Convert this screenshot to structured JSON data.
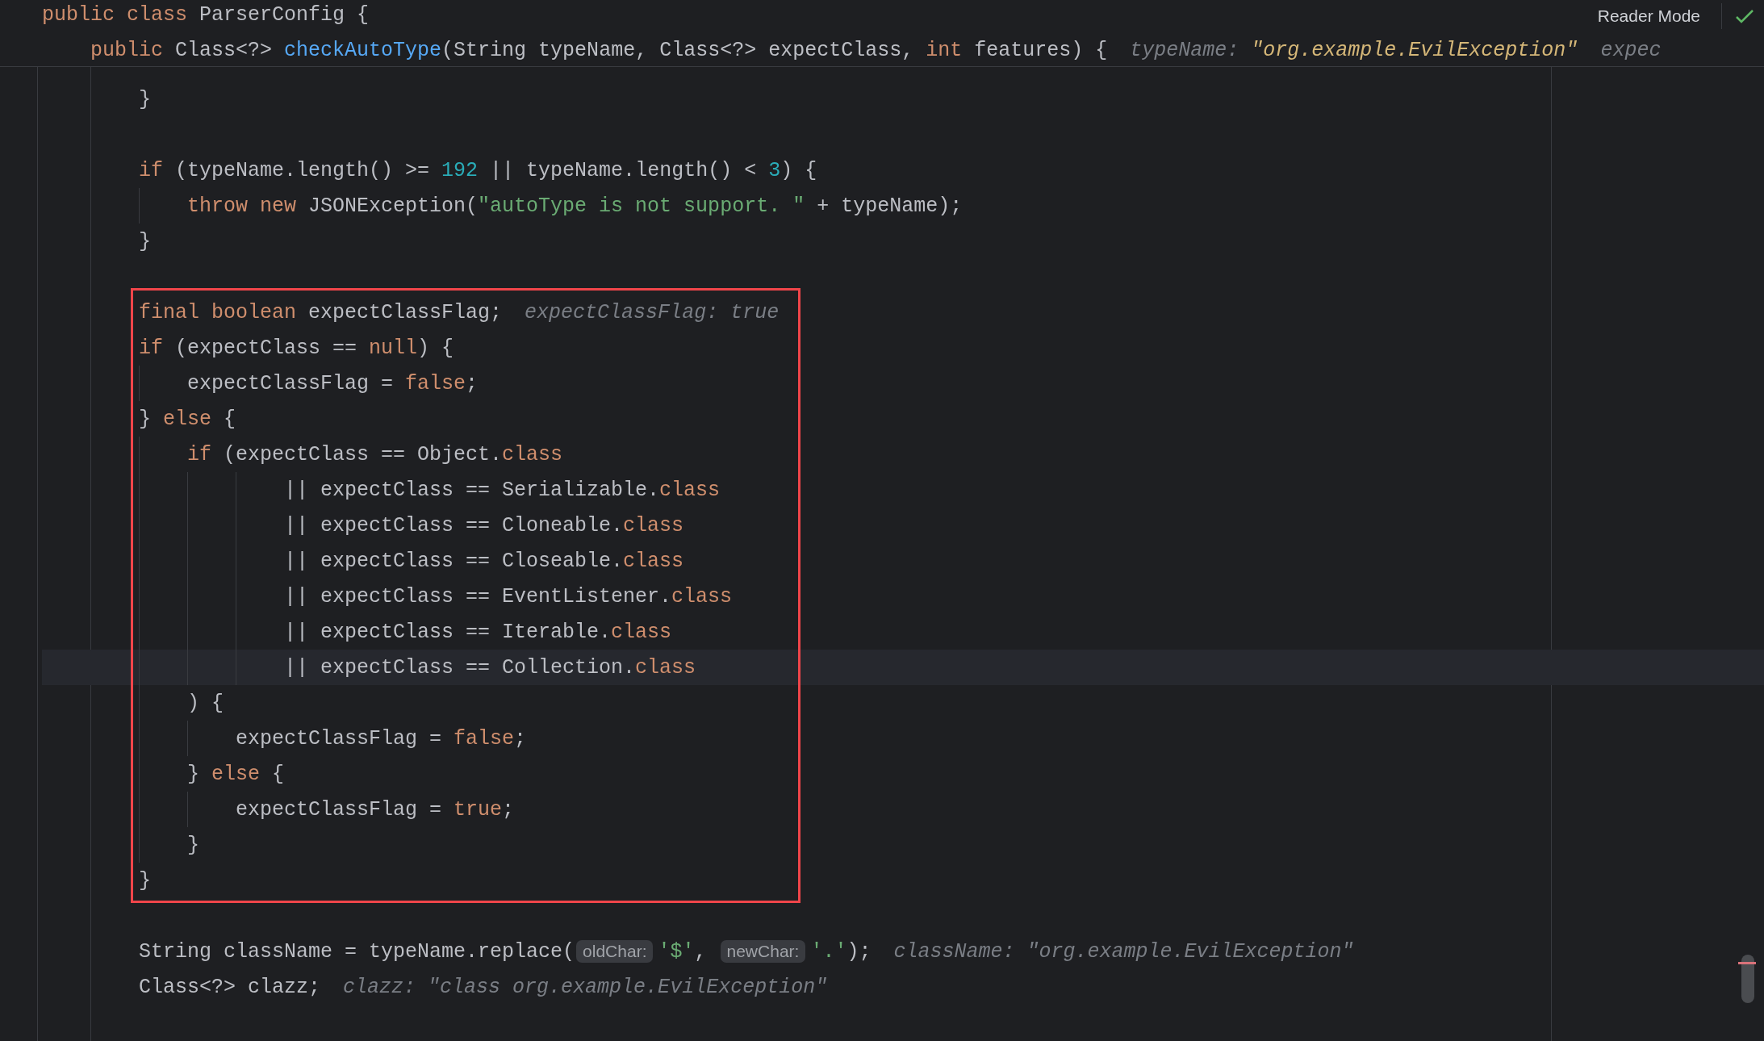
{
  "sticky_header": {
    "lines": [
      {
        "kind": "code",
        "code": [
          {
            "kind": "keyword",
            "text": "public class"
          },
          {
            "kind": "plain",
            "text": " ParserConfig {"
          }
        ],
        "children": [
          {
            "kind": "code",
            "code": [
              {
                "kind": "keyword",
                "text": "public"
              },
              {
                "kind": "plain",
                "text": " Class<?> "
              },
              {
                "kind": "function",
                "text": "checkAutoType"
              },
              {
                "kind": "plain",
                "text": "(String typeName, Class<?> expectClass, "
              },
              {
                "kind": "keyword",
                "text": "int"
              },
              {
                "kind": "plain",
                "text": " features) {"
              },
              {
                "kind": "debug",
                "name": "typeName:",
                "value": "\"org.example.EvilException\"",
                "changed": true
              },
              {
                "kind": "debug",
                "name": "expec"
              }
            ]
          }
        ]
      }
    ]
  },
  "reader_mode": {
    "label": "Reader Mode",
    "checked": true
  },
  "editor": {
    "sections": [
      {
        "kind": "plain",
        "lines": [
          {
            "kind": "code",
            "current": false,
            "code": [
              {
                "kind": "plain",
                "text": "}"
              }
            ]
          },
          {
            "kind": "blank"
          },
          {
            "kind": "code",
            "current": false,
            "code": [
              {
                "kind": "keyword",
                "text": "if"
              },
              {
                "kind": "plain",
                "text": " (typeName.length() >= "
              },
              {
                "kind": "number",
                "text": "192"
              },
              {
                "kind": "plain",
                "text": " || typeName.length() < "
              },
              {
                "kind": "number",
                "text": "3"
              },
              {
                "kind": "plain",
                "text": ") {"
              }
            ],
            "children": [
              {
                "kind": "code",
                "current": false,
                "code": [
                  {
                    "kind": "keyword",
                    "text": "throw new"
                  },
                  {
                    "kind": "plain",
                    "text": " JSONException("
                  },
                  {
                    "kind": "string",
                    "text": "\"autoType is not support. \""
                  },
                  {
                    "kind": "plain",
                    "text": " + typeName);"
                  }
                ]
              }
            ]
          },
          {
            "kind": "code",
            "current": false,
            "code": [
              {
                "kind": "plain",
                "text": "}"
              }
            ]
          },
          {
            "kind": "blank"
          }
        ]
      },
      {
        "kind": "boxed",
        "lines": [
          {
            "kind": "code",
            "current": false,
            "code": [
              {
                "kind": "keyword",
                "text": "final boolean"
              },
              {
                "kind": "plain",
                "text": " expectClassFlag;"
              },
              {
                "kind": "debug",
                "name": "expectClassFlag:",
                "value": "true",
                "changed": false
              }
            ]
          },
          {
            "kind": "code",
            "current": false,
            "code": [
              {
                "kind": "keyword",
                "text": "if"
              },
              {
                "kind": "plain",
                "text": " (expectClass == "
              },
              {
                "kind": "keyword",
                "text": "null"
              },
              {
                "kind": "plain",
                "text": ") {"
              }
            ],
            "children": [
              {
                "kind": "code",
                "current": false,
                "code": [
                  {
                    "kind": "plain",
                    "text": "expectClassFlag = "
                  },
                  {
                    "kind": "keyword",
                    "text": "false"
                  },
                  {
                    "kind": "plain",
                    "text": ";"
                  }
                ]
              }
            ]
          },
          {
            "kind": "code",
            "current": false,
            "code": [
              {
                "kind": "plain",
                "text": "} "
              },
              {
                "kind": "keyword",
                "text": "else"
              },
              {
                "kind": "plain",
                "text": " {"
              }
            ],
            "children": [
              {
                "kind": "code",
                "current": false,
                "code": [
                  {
                    "kind": "keyword",
                    "text": "if"
                  },
                  {
                    "kind": "plain",
                    "text": " (expectClass == Object."
                  },
                  {
                    "kind": "keyword",
                    "text": "class"
                  }
                ],
                "children": [
                  {
                    "kind": "continuation",
                    "current": false,
                    "code": [
                      {
                        "kind": "plain",
                        "text": "|| expectClass == Serializable."
                      },
                      {
                        "kind": "keyword",
                        "text": "class"
                      }
                    ]
                  },
                  {
                    "kind": "continuation",
                    "current": false,
                    "code": [
                      {
                        "kind": "plain",
                        "text": "|| expectClass == Cloneable."
                      },
                      {
                        "kind": "keyword",
                        "text": "class"
                      }
                    ]
                  },
                  {
                    "kind": "continuation",
                    "current": false,
                    "code": [
                      {
                        "kind": "plain",
                        "text": "|| expectClass == Closeable."
                      },
                      {
                        "kind": "keyword",
                        "text": "class"
                      }
                    ]
                  },
                  {
                    "kind": "continuation",
                    "current": false,
                    "code": [
                      {
                        "kind": "plain",
                        "text": "|| expectClass == EventListener."
                      },
                      {
                        "kind": "keyword",
                        "text": "class"
                      }
                    ]
                  },
                  {
                    "kind": "continuation",
                    "current": false,
                    "code": [
                      {
                        "kind": "plain",
                        "text": "|| expectClass == Iterable."
                      },
                      {
                        "kind": "keyword",
                        "text": "class"
                      }
                    ]
                  },
                  {
                    "kind": "continuation",
                    "current": true,
                    "code": [
                      {
                        "kind": "plain",
                        "text": "|| expectClass == Collection."
                      },
                      {
                        "kind": "keyword",
                        "text": "class"
                      }
                    ]
                  }
                ]
              },
              {
                "kind": "code",
                "current": false,
                "code": [
                  {
                    "kind": "plain",
                    "text": ") {"
                  }
                ],
                "children": [
                  {
                    "kind": "code",
                    "current": false,
                    "code": [
                      {
                        "kind": "plain",
                        "text": "expectClassFlag = "
                      },
                      {
                        "kind": "keyword",
                        "text": "false"
                      },
                      {
                        "kind": "plain",
                        "text": ";"
                      }
                    ]
                  }
                ]
              },
              {
                "kind": "code",
                "current": false,
                "code": [
                  {
                    "kind": "plain",
                    "text": "} "
                  },
                  {
                    "kind": "keyword",
                    "text": "else"
                  },
                  {
                    "kind": "plain",
                    "text": " {"
                  }
                ],
                "children": [
                  {
                    "kind": "code",
                    "current": false,
                    "code": [
                      {
                        "kind": "plain",
                        "text": "expectClassFlag = "
                      },
                      {
                        "kind": "keyword",
                        "text": "true"
                      },
                      {
                        "kind": "plain",
                        "text": ";"
                      }
                    ]
                  }
                ]
              },
              {
                "kind": "code",
                "current": false,
                "code": [
                  {
                    "kind": "plain",
                    "text": "}"
                  }
                ]
              }
            ]
          },
          {
            "kind": "code",
            "current": false,
            "code": [
              {
                "kind": "plain",
                "text": "}"
              }
            ]
          }
        ]
      },
      {
        "kind": "plain",
        "lines": [
          {
            "kind": "blank"
          },
          {
            "kind": "code",
            "current": false,
            "code": [
              {
                "kind": "plain",
                "text": "String className = typeName.replace("
              },
              {
                "kind": "param",
                "text": "oldChar:"
              },
              {
                "kind": "string",
                "text": "'$'"
              },
              {
                "kind": "plain",
                "text": ", "
              },
              {
                "kind": "param",
                "text": "newChar:"
              },
              {
                "kind": "string",
                "text": "'.'"
              },
              {
                "kind": "plain",
                "text": ");"
              },
              {
                "kind": "debug",
                "name": "className:",
                "value": "\"org.example.EvilException\"",
                "changed": false
              }
            ]
          },
          {
            "kind": "code",
            "current": false,
            "code": [
              {
                "kind": "plain",
                "text": "Class<?> clazz;"
              },
              {
                "kind": "debug",
                "name": "clazz:",
                "value": "\"class org.example.EvilException\"",
                "changed": false
              }
            ]
          }
        ]
      }
    ]
  }
}
